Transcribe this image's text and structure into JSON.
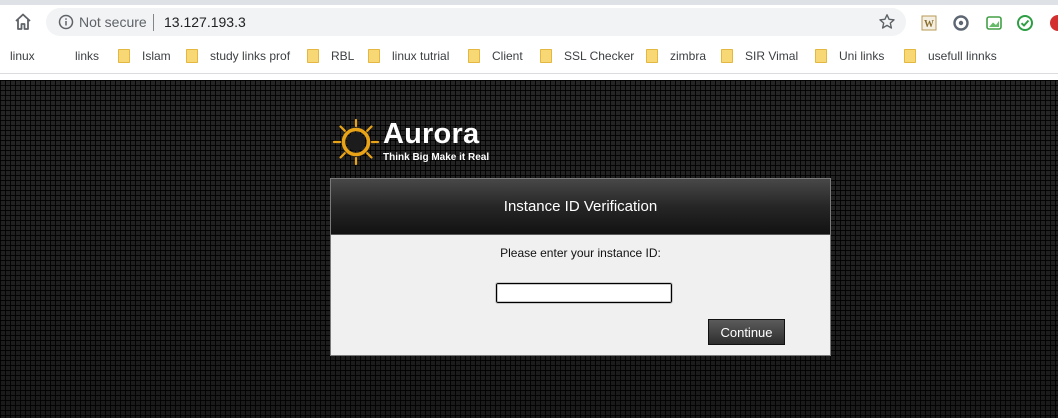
{
  "browser": {
    "security_label": "Not secure",
    "url": "13.127.193.3",
    "bookmarks": [
      {
        "label": "linux",
        "folder": false
      },
      {
        "label": "links",
        "folder": false
      },
      {
        "label": "Islam",
        "folder": true
      },
      {
        "label": "study links prof",
        "folder": true
      },
      {
        "label": "RBL",
        "folder": true
      },
      {
        "label": "linux tutrial",
        "folder": true
      },
      {
        "label": "Client",
        "folder": true
      },
      {
        "label": "SSL Checker",
        "folder": true
      },
      {
        "label": "zimbra",
        "folder": true
      },
      {
        "label": "SIR Vimal",
        "folder": true
      },
      {
        "label": "Uni links",
        "folder": true
      },
      {
        "label": "usefull linnks",
        "folder": true
      }
    ],
    "extension_icons": [
      "w-extension-icon",
      "circle-extension-icon",
      "image-extension-icon",
      "check-extension-icon",
      "ab-extension-icon"
    ]
  },
  "page": {
    "logo": {
      "name": "Aurora",
      "tagline": "Think Big Make it Real"
    },
    "panel": {
      "title": "Instance ID Verification",
      "prompt": "Please enter your instance ID:",
      "input_value": "",
      "button_label": "Continue"
    }
  },
  "colors": {
    "logo_sun": "#e8a317",
    "panel_header": "#262626",
    "panel_body": "#f0f0f0"
  }
}
